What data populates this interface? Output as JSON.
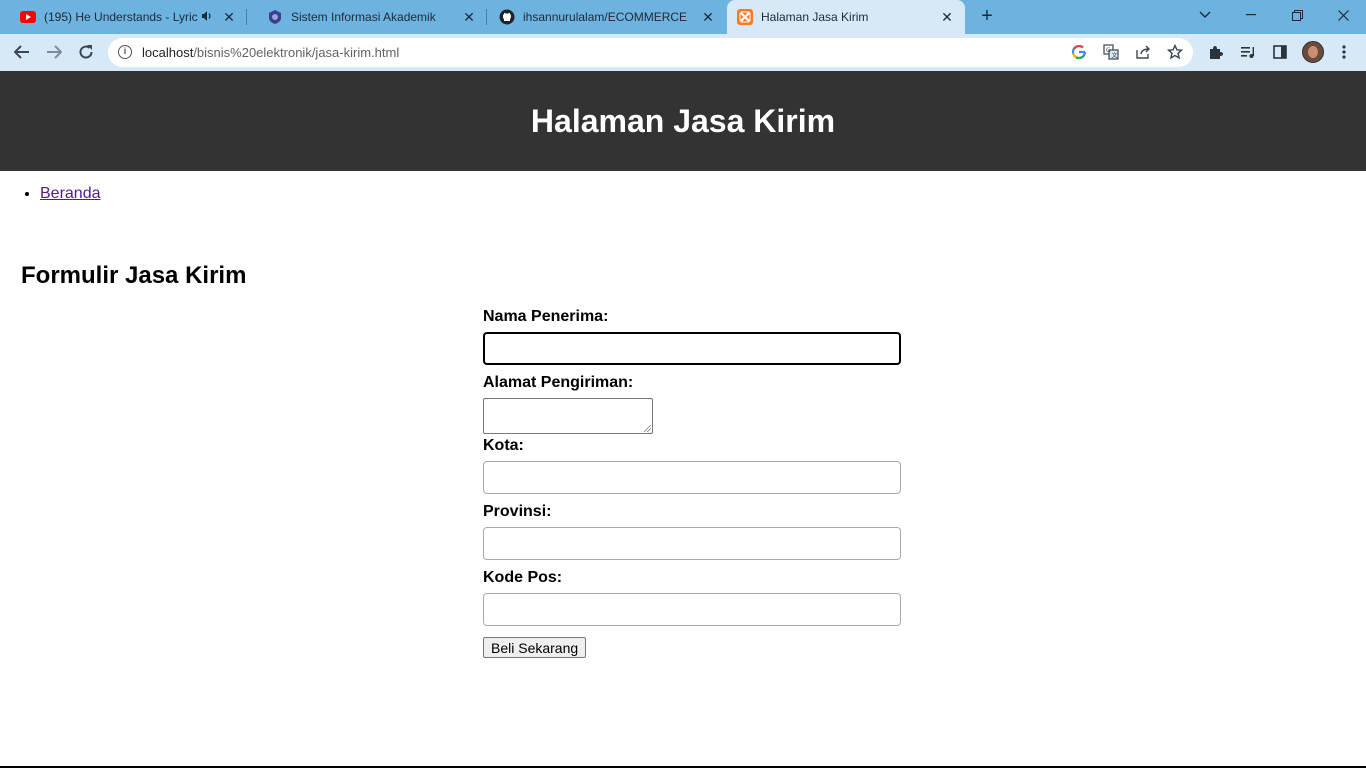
{
  "browser": {
    "tabs": [
      {
        "title": "(195) He Understands - Lyric",
        "favicon": "youtube-icon",
        "audio": true
      },
      {
        "title": "Sistem Informasi Akademik",
        "favicon": "academic-shield-icon"
      },
      {
        "title": "ihsannurulalam/ECOMMERCE",
        "favicon": "github-icon"
      },
      {
        "title": "Halaman Jasa Kirim",
        "favicon": "xampp-icon",
        "active": true
      }
    ],
    "url_host": "localhost",
    "url_path": "/bisnis%20elektronik/jasa-kirim.html"
  },
  "page": {
    "header_title": "Halaman Jasa Kirim",
    "nav": [
      {
        "label": "Beranda"
      }
    ],
    "form_title": "Formulir Jasa Kirim",
    "fields": {
      "nama_label": "Nama Penerima:",
      "alamat_label": "Alamat Pengiriman:",
      "kota_label": "Kota:",
      "provinsi_label": "Provinsi:",
      "kodepos_label": "Kode Pos:"
    },
    "submit_label": "Beli Sekarang"
  },
  "colors": {
    "tabstrip": "#6cb3e0",
    "toolbar": "#d7e9f6",
    "page_header": "#333333",
    "link_visited": "#551a8b"
  }
}
